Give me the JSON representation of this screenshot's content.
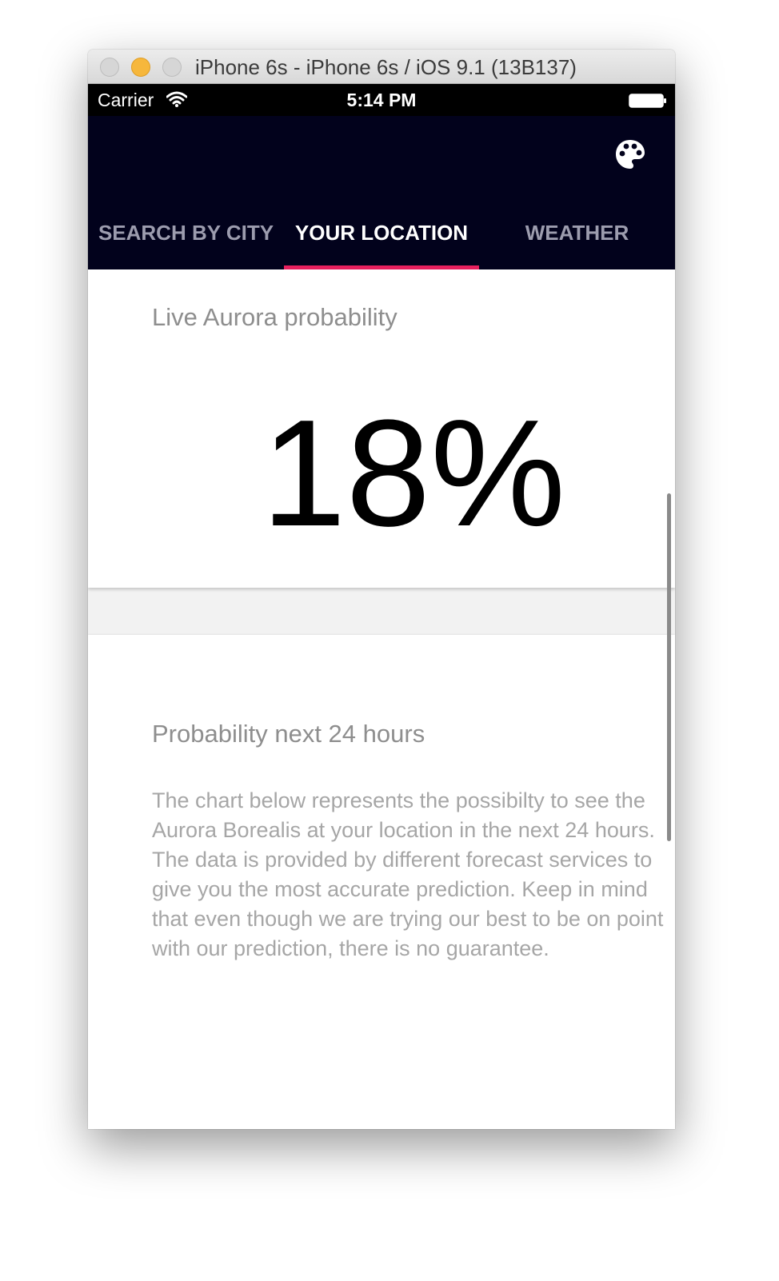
{
  "window": {
    "title": "iPhone 6s - iPhone 6s / iOS 9.1 (13B137)"
  },
  "status_bar": {
    "carrier": "Carrier",
    "time": "5:14 PM"
  },
  "tabs": [
    {
      "label": "SEARCH BY CITY",
      "selected": false
    },
    {
      "label": "YOUR LOCATION",
      "selected": true
    },
    {
      "label": "WEATHER",
      "selected": false
    }
  ],
  "live_card": {
    "title": "Live Aurora probability",
    "value": "18%"
  },
  "forecast_card": {
    "title": "Probability next 24 hours",
    "description": "The chart below represents the possibilty to see the Aurora Borealis at your location in the next 24 hours. The data is provided by different forecast services to give you the most accurate prediction. Keep in mind that even though we are trying our best to be on point with our prediction, there is no guarantee."
  },
  "icons": [
    "wifi-icon",
    "battery-icon",
    "palette-icon"
  ],
  "colors": {
    "app_bar": "#02021c",
    "tab_indicator": "#e8205e",
    "tab_inactive": "#9c9cae",
    "tab_active": "#ffffff"
  }
}
